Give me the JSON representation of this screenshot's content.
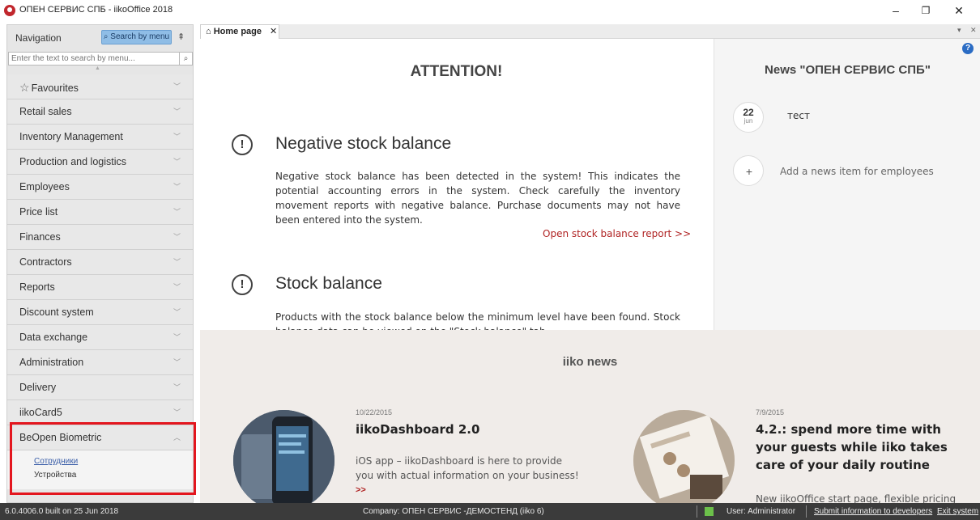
{
  "window": {
    "title": "ОПЕН СЕРВИС СПБ - iikoOffice 2018",
    "controls": {
      "minimize": "–",
      "restore": "❐",
      "close": "✕"
    }
  },
  "sidebar": {
    "title": "Navigation",
    "search_by_menu": "Search by menu",
    "search_placeholder": "Enter the text to search by menu...",
    "items": [
      {
        "label": "Favourites",
        "icon": "star-icon"
      },
      {
        "label": "Retail sales"
      },
      {
        "label": "Inventory Management"
      },
      {
        "label": "Production and logistics"
      },
      {
        "label": "Employees"
      },
      {
        "label": "Price list"
      },
      {
        "label": "Finances"
      },
      {
        "label": "Contractors"
      },
      {
        "label": "Reports"
      },
      {
        "label": "Discount system"
      },
      {
        "label": "Data exchange"
      },
      {
        "label": "Administration"
      },
      {
        "label": "Delivery"
      },
      {
        "label": "iikoCard5"
      },
      {
        "label": "BeOpen Biometric",
        "expanded": true
      }
    ],
    "subitems": [
      "Сотрудники",
      "Устройства"
    ]
  },
  "tabs": [
    {
      "label": "Home page",
      "icon": "home-icon"
    }
  ],
  "attention": {
    "heading": "ATTENTION!",
    "alerts": [
      {
        "title": "Negative stock balance",
        "text": "Negative stock balance has been detected in the system! This indicates the potential accounting errors in the system. Check carefully the inventory movement reports with negative balance. Purchase documents may not have been entered into the system.",
        "link": "Open stock balance report >>"
      },
      {
        "title": "Stock balance",
        "text": "Products with the stock balance below the minimum level have been found. Stock balance data can be viewed on the \"Stock balance\" tab."
      }
    ]
  },
  "news": {
    "title": "News \"ОПЕН СЕРВИС СПБ\"",
    "items": [
      {
        "day": "22",
        "month": "jun",
        "text": "тест"
      }
    ],
    "add_label": "Add a news item for employees",
    "add_icon": "+"
  },
  "iiko_news": {
    "title": "iiko news",
    "articles": [
      {
        "date": "10/22/2015",
        "title": "iikoDashboard 2.0",
        "text": "iOS app – iikoDashboard is here to provide you with actual information on your business!",
        "more": ">>"
      },
      {
        "date": "7/9/2015",
        "title": "4.2.: spend more time with your guests while iiko takes care of your daily routine",
        "text": "New iikoOffice start page, flexible pricing"
      }
    ]
  },
  "status": {
    "version": "6.0.4006.0 built on 25 Jun 2018",
    "company": "Company: ОПЕН СЕРВИС -ДЕМОСТЕНД (iiko 6)",
    "user": "User: Administrator",
    "submit": "Submit information to developers",
    "exit": "Exit system",
    "indicator_color": "#6cc04a"
  },
  "colors": {
    "accent_link": "#b02323",
    "highlight": "#e3161e",
    "search_button": "#8fbde6"
  }
}
